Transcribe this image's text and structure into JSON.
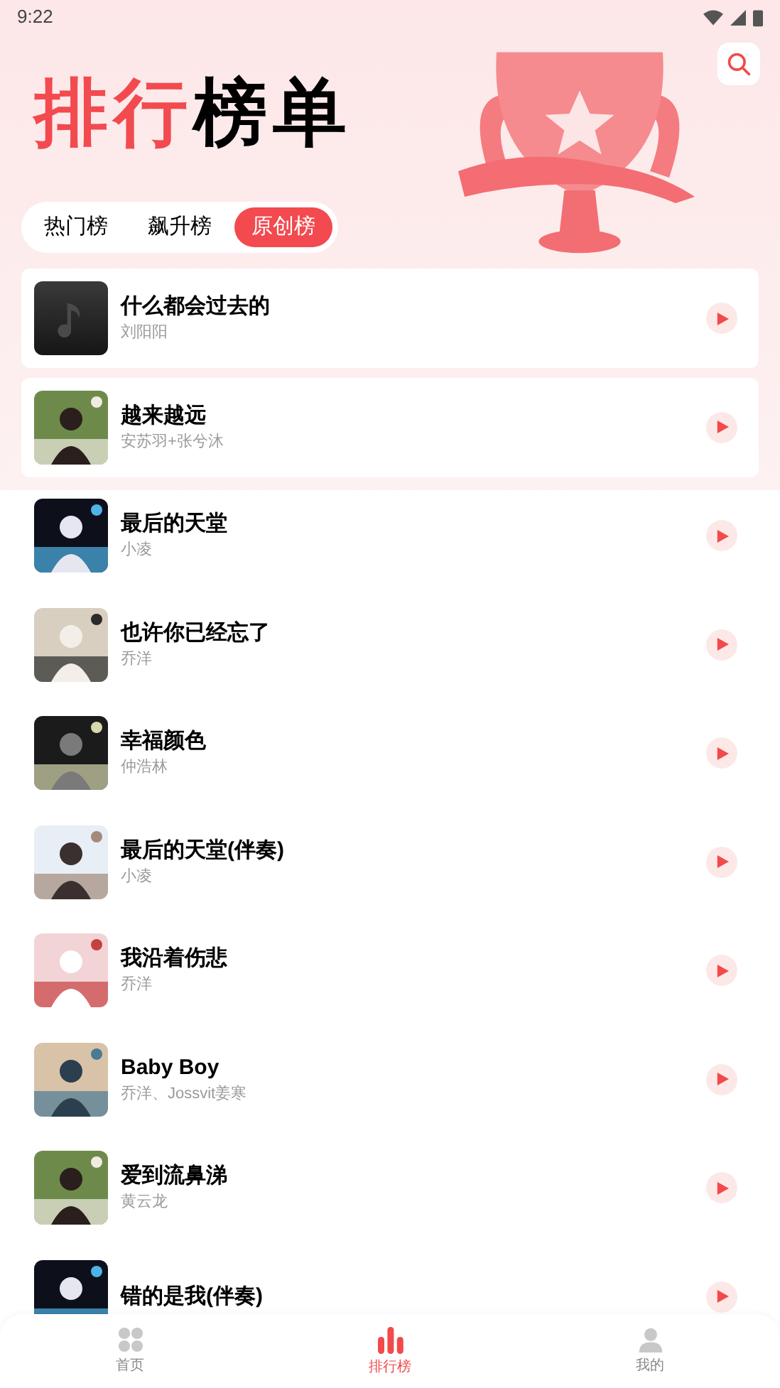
{
  "status_bar": {
    "time": "9:22"
  },
  "header": {
    "title": [
      {
        "text": "排行",
        "accent": true
      },
      {
        "text": "榜单",
        "accent": false
      }
    ]
  },
  "tabs": [
    {
      "label": "热门榜",
      "selected": false
    },
    {
      "label": "飙升榜",
      "selected": false
    },
    {
      "label": "原创榜",
      "selected": true
    }
  ],
  "songs": [
    {
      "title": "什么都会过去的",
      "artist": "刘阳阳",
      "kind": "placeholder"
    },
    {
      "title": "越来越远",
      "artist": "安苏羽+张兮沐",
      "kind": "picture"
    },
    {
      "title": "最后的天堂",
      "artist": "小凌",
      "kind": "picture"
    },
    {
      "title": "也许你已经忘了",
      "artist": "乔洋",
      "kind": "picture"
    },
    {
      "title": "幸福颜色",
      "artist": "仲浩林",
      "kind": "picture"
    },
    {
      "title": "最后的天堂(伴奏)",
      "artist": "小凌",
      "kind": "picture"
    },
    {
      "title": "我沿着伤悲",
      "artist": "乔洋",
      "kind": "picture"
    },
    {
      "title": "Baby Boy",
      "artist": "乔洋、Jossvit姜寒",
      "kind": "picture"
    },
    {
      "title": "爱到流鼻涕",
      "artist": "黄云龙",
      "kind": "picture"
    },
    {
      "title": "错的是我(伴奏)",
      "kind": "picture"
    }
  ],
  "bottom_nav": [
    {
      "label": "首页",
      "selected": false,
      "kind": "grid"
    },
    {
      "label": "排行榜",
      "selected": true,
      "kind": "bars"
    },
    {
      "label": "我的",
      "selected": false,
      "kind": "user"
    }
  ]
}
